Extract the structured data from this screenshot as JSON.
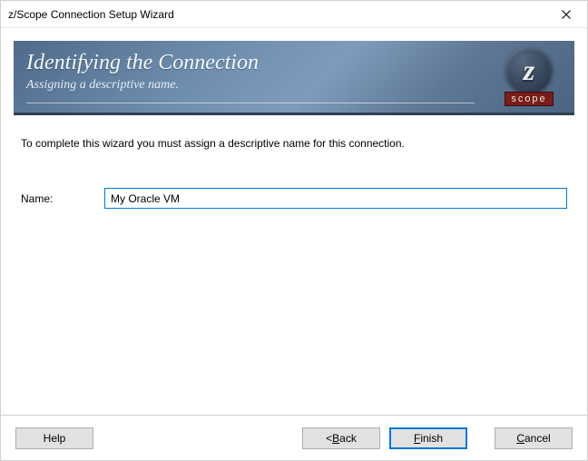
{
  "window": {
    "title": "z/Scope Connection Setup Wizard"
  },
  "header": {
    "title": "Identifying the Connection",
    "subtitle": "Assigning a descriptive name."
  },
  "logo": {
    "glyph": "z",
    "label": "scope"
  },
  "body": {
    "instruction": "To complete this wizard you must assign a descriptive name for this connection."
  },
  "form": {
    "name_label": "Name:",
    "name_value": "My Oracle VM"
  },
  "footer": {
    "help": "Help",
    "back_prefix": "< ",
    "back_mnemonic": "B",
    "back_rest": "ack",
    "finish_mnemonic": "F",
    "finish_rest": "inish",
    "cancel_mnemonic": "C",
    "cancel_rest": "ancel"
  }
}
